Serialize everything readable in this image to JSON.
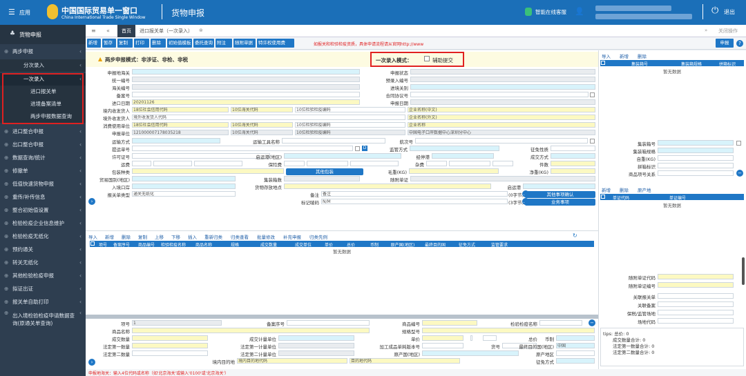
{
  "header": {
    "menu_label": "应用",
    "brand_cn": "中国国际贸易单一窗口",
    "brand_en": "China International Trade Single Window",
    "section": "货物申报",
    "service_label": "智能在线客服",
    "logout_label": "退出"
  },
  "sidebar": {
    "title": "货物申报",
    "items": [
      {
        "label": "两步申报",
        "level": 0
      },
      {
        "label": "分次录入",
        "level": 1
      },
      {
        "label": "一次录入",
        "level": 1
      },
      {
        "label": "进口报关单",
        "level": 2
      },
      {
        "label": "进境备案清单",
        "level": 2
      },
      {
        "label": "两步申报数据查询",
        "level": 2
      },
      {
        "label": "进口整合申报",
        "level": 0
      },
      {
        "label": "出口整合申报",
        "level": 0
      },
      {
        "label": "数据查询/统计",
        "level": 0
      },
      {
        "label": "修撤单",
        "level": 0
      },
      {
        "label": "低值快速货物申报",
        "level": 0
      },
      {
        "label": "重传/补传信息",
        "level": 0
      },
      {
        "label": "整合初始值设置",
        "level": 0
      },
      {
        "label": "检验检疫企业信息维护",
        "level": 0
      },
      {
        "label": "检验检疫无纸化",
        "level": 0
      },
      {
        "label": "预约通关",
        "level": 0
      },
      {
        "label": "转关无纸化",
        "level": 0
      },
      {
        "label": "其他检验检疫申报",
        "level": 0
      },
      {
        "label": "拟证出证",
        "level": 0
      },
      {
        "label": "报关单自助打印",
        "level": 0
      },
      {
        "label": "出入境检验检疫申请数据查询(原通关单查询)",
        "level": 0
      }
    ]
  },
  "tabs": {
    "home": "首页",
    "active_tab": "进口报关单（一次录入）",
    "close_ops": "关闭操作"
  },
  "toolbar": {
    "buttons": [
      "新增",
      "暂存",
      "复制",
      "打印",
      "删除",
      "初始值模板",
      "委托查询",
      "附注",
      "随附单据",
      "特许权使用费"
    ],
    "notice": "如报关和检验检疫资质，具体申请流程请从官网http://www",
    "declare": "申报"
  },
  "mode": {
    "warning": "两步申报模式：非涉证、非检、非税",
    "entry_mode_label": "一次录入模式：",
    "assist_label": "辅助提交"
  },
  "form": {
    "declare_port_label": "申报地海关",
    "declare_status_label": "申报状态",
    "unified_no_label": "统一编号",
    "pre_entry_label": "预录入编号",
    "customs_no_label": "海关编号",
    "entry_type_label": "进境关别",
    "record_no_label": "备案号",
    "contract_label": "合同协议号",
    "import_date_label": "进口日期",
    "import_date": "20201126",
    "declare_date_label": "申报日期",
    "consignee_label": "境内收发货人",
    "ph_social": "18位社会信用代码",
    "ph_customs10": "10位海关代码",
    "ph_ciq10": "10位检验检疫编码",
    "ph_company_cn": "企业名称(中文)",
    "foreign_consignor_label": "境外收发货人",
    "ph_foreign": "境外收发货人代码",
    "ph_company_en": "企业名称(外文)",
    "consumer_label": "消费使用单位",
    "ph_company": "企业名称",
    "declare_unit_label": "申报单位",
    "declare_unit_code": "121000007178035218",
    "declare_unit_name": "中国电子口岸数据中心深圳分中心",
    "transport_label": "运输方式",
    "transport_tool_label": "运输工具名称",
    "voyage_label": "航次号",
    "bill_label": "提运单号",
    "supervision_label": "监管方式",
    "tax_nature_label": "征免性质",
    "license_label": "许可证号",
    "origin_port_label": "启运港(地区)",
    "dest_port_label": "经停港",
    "deal_mode_label": "成交方式",
    "freight_label": "运费",
    "insurance_label": "保险费",
    "misc_label": "杂费",
    "pieces_label": "件数",
    "package_label": "包装种类",
    "other_package": "其他包装",
    "gross_label": "毛重(KG)",
    "net_label": "净重(KG)",
    "trade_country_label": "贸易国别(地区)",
    "container_count_label": "集装箱数",
    "doc_attach_label": "随附单证",
    "entry_port_label": "入境口岸",
    "goods_place_label": "货物存放地点",
    "start_port_label": "启运港",
    "declare_type_label": "报关单类型",
    "declare_type_value": "通关无纸化",
    "remark_label": "备注",
    "remark_ph": "备注",
    "char_count": "(0字节)",
    "other_items": "其他事项确认",
    "mark_label": "标记唛码",
    "mark_value": "N/M",
    "char_count2": "(3字节)",
    "business_items": "业务事项"
  },
  "goods_table": {
    "actions": [
      "导入",
      "新增",
      "删除",
      "复制",
      "上移",
      "下移",
      "插入",
      "重新归类",
      "归类查看",
      "批量修改",
      "补充申报",
      "归类先例"
    ],
    "headers": [
      "项号",
      "备案序号",
      "商品编号",
      "检验检疫名称",
      "商品名称",
      "规格",
      "成交数量",
      "成交单位",
      "单价",
      "总价",
      "币制",
      "原产国(地区)",
      "最终目的国",
      "征免方式",
      "监管要求"
    ],
    "empty": "暂无数据"
  },
  "item_form": {
    "item_no_label": "项号",
    "item_no": "1",
    "record_seq_label": "备案序号",
    "goods_code_label": "商品编号",
    "ciq_name_label": "检验检疫名称",
    "goods_name_label": "商品名称",
    "spec_label": "规格型号",
    "deal_qty_label": "成交数量",
    "deal_unit_label": "成交计量单位",
    "unit_price_label": "单价",
    "total_price_label": "总价",
    "currency_label": "币制",
    "legal_qty1_label": "法定第一数量",
    "legal_unit1_label": "法定第一计量单位",
    "processing_label": "加工成品单耗版本号",
    "goods_no_label": "货号",
    "final_dest_label": "最终目的国(地区)",
    "final_dest_value": "中国",
    "legal_qty2_label": "法定第二数量",
    "legal_unit2_label": "法定第二计量单位",
    "origin_country_label": "原产国(地区)",
    "origin_region_label": "原产地区",
    "dest_place_label": "境内目的地",
    "dest_place_ph": "境内目的地代码",
    "dest_area_ph": "目的地代码",
    "tax_label": "征免方式"
  },
  "right_panel": {
    "actions": [
      "导入",
      "新增",
      "删除"
    ],
    "headers": [
      "集装箱号",
      "集装箱规格",
      "拼箱标识"
    ],
    "empty": "暂无数据",
    "container_no": "集装箱号",
    "container_spec": "集装箱规格",
    "self_weight": "自重(KG)",
    "lcl_flag": "拼箱标识",
    "goods_relation": "商品项号关系",
    "doc_actions": [
      "新增",
      "删除",
      "原产地"
    ],
    "doc_headers": [
      "单证代码",
      "单证编号"
    ],
    "doc_empty": "暂无数据",
    "doc_code": "随附单证代码",
    "doc_no": "随附单证编号",
    "rel_declare": "关联报关单",
    "rel_record": "关联备案",
    "bond_place": "保税/监管场地",
    "yard_code": "场地代码",
    "tips": [
      "tips: 总价: 0",
      "成交数量合计: 0",
      "法定第一数量合计: 0",
      "法定第二数量合计: 0"
    ]
  },
  "status_bar": "申报地海关：输入4位代码或名称（如'北京海关'或输入'0100'或'北京海关'）",
  "colors": {
    "header": "#1b6fb8",
    "sidebar": "#2e3e50",
    "accent": "#1f77c6",
    "highlight": "#e02020"
  }
}
